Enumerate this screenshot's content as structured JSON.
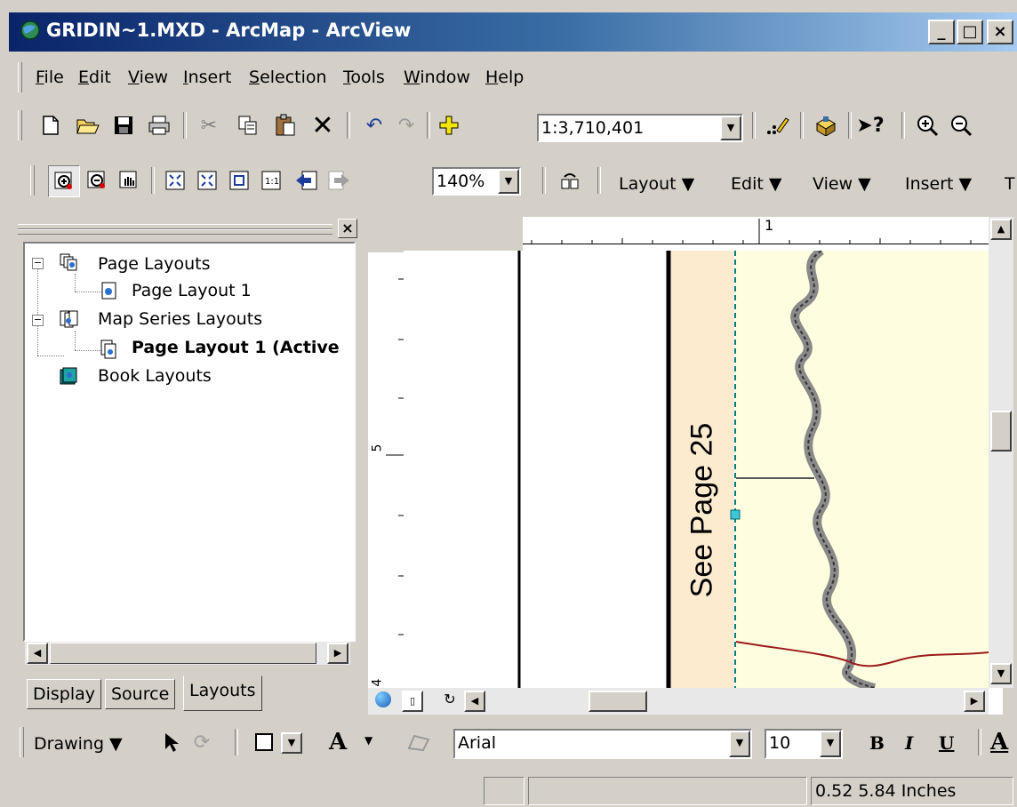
{
  "window": {
    "title": "GRIDIN~1.MXD - ArcMap - ArcView",
    "minimize": "_",
    "maximize": "□",
    "close": "×"
  },
  "menu": [
    {
      "label": "File",
      "ul": "F",
      "rest": "ile"
    },
    {
      "label": "Edit",
      "ul": "E",
      "rest": "dit"
    },
    {
      "label": "View",
      "ul": "V",
      "rest": "iew"
    },
    {
      "label": "Insert",
      "ul": "I",
      "rest": "nsert"
    },
    {
      "label": "Selection",
      "ul": "S",
      "rest": "election"
    },
    {
      "label": "Tools",
      "ul": "T",
      "rest": "ools"
    },
    {
      "label": "Window",
      "ul": "W",
      "rest": "indow"
    },
    {
      "label": "Help",
      "ul": "H",
      "rest": "elp"
    }
  ],
  "standard_toolbar": {
    "scale_value": "1:3,710,401"
  },
  "layout_toolbar": {
    "zoom_percent": "140%",
    "menus": [
      "Layout ▼",
      "Edit ▼",
      "View ▼",
      "Insert ▼",
      "T"
    ]
  },
  "toc": {
    "items": [
      {
        "label": "Page Layouts",
        "bold": false
      },
      {
        "label": "Page Layout 1",
        "bold": false
      },
      {
        "label": "Map Series Layouts",
        "bold": false
      },
      {
        "label": "Page Layout 1 (Active",
        "bold": true
      },
      {
        "label": "Book Layouts",
        "bold": false
      }
    ],
    "tabs": [
      "Display",
      "Source",
      "Layouts"
    ],
    "active_tab": "Layouts"
  },
  "layout_view": {
    "hruler_label": "1",
    "vruler_labels": [
      "5",
      "4"
    ],
    "map_text": "See Page 25",
    "colors": {
      "page_bg": "#fffde0",
      "strip_bg": "#fdebd0",
      "river": "#8a8a8a",
      "road": "#9b1b1b",
      "grid_line": "#008080"
    }
  },
  "drawing_toolbar": {
    "drawing_label": "Drawing ▼",
    "font_name": "Arial",
    "font_size": "10",
    "bold": "B",
    "italic": "I",
    "underline": "U",
    "text_tool": "A"
  },
  "status_bar": {
    "coordinates": "0.52  5.84 Inches"
  }
}
